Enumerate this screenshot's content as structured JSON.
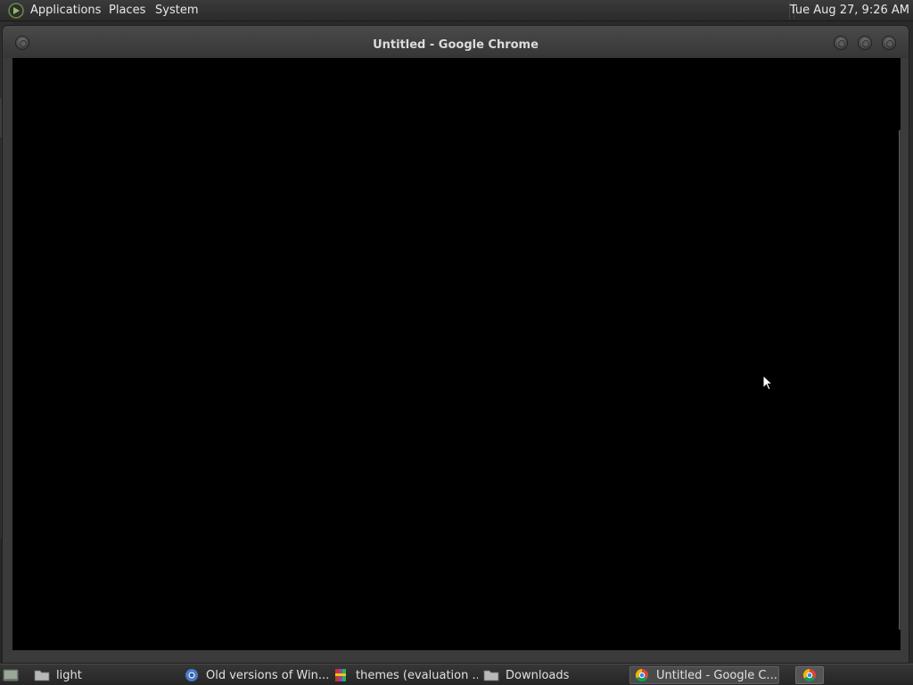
{
  "top_panel": {
    "menus": [
      "Applications",
      "Places",
      "System"
    ],
    "clock": "Tue Aug 27,  9:26 AM"
  },
  "window": {
    "title": "Untitled - Google Chrome"
  },
  "taskbar": {
    "tasks": [
      {
        "label": "light",
        "icon": "folder-icon"
      },
      {
        "label": "Old versions of Win...",
        "icon": "chrome-icon"
      },
      {
        "label": "themes (evaluation ...",
        "icon": "archive-icon"
      },
      {
        "label": "Downloads",
        "icon": "folder-icon"
      },
      {
        "label": "Untitled - Google C...",
        "icon": "chrome-icon",
        "active": true
      }
    ]
  },
  "colors": {
    "panel": "#2b2b2b",
    "content": "#000000",
    "accent_green": "#6aa84f"
  }
}
